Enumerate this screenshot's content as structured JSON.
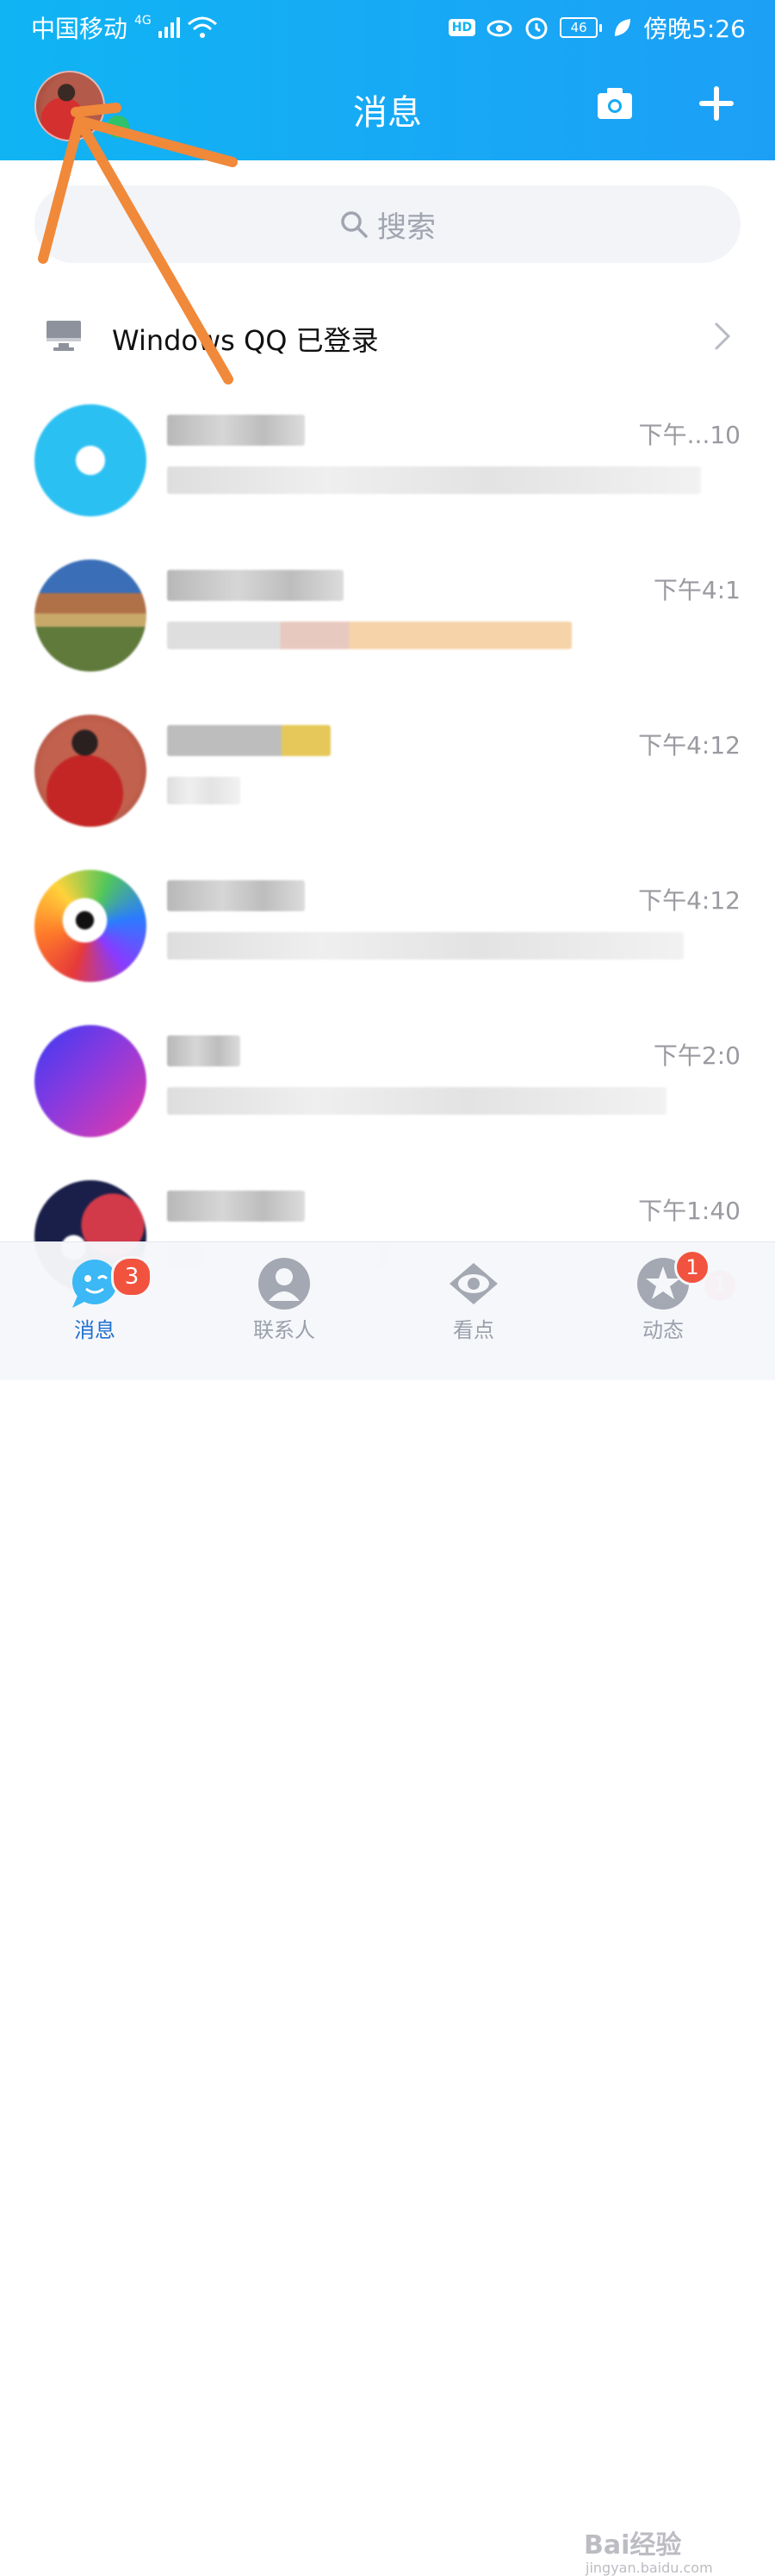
{
  "status_bar": {
    "carrier": "中国移动",
    "network": "4G",
    "hd": "HD",
    "battery": "46",
    "time": "傍晚5:26"
  },
  "header": {
    "title": "消息",
    "camera_icon": "camera-icon",
    "add_icon": "plus-icon"
  },
  "search": {
    "placeholder": "搜索",
    "icon": "search-icon"
  },
  "device_login": {
    "label": "Windows QQ 已登录",
    "icon": "monitor-icon"
  },
  "conversations": [
    {
      "time": "下午...10",
      "badge": ""
    },
    {
      "time": "下午4:1",
      "badge": ""
    },
    {
      "time": "下午4:12",
      "badge": ""
    },
    {
      "time": "下午4:12",
      "badge": ""
    },
    {
      "time": "下午2:0",
      "badge": ""
    },
    {
      "time": "下午1:40",
      "badge": "1"
    }
  ],
  "tabs": [
    {
      "label": "消息",
      "badge": "3",
      "icon": "chat-bubble-icon",
      "active": true
    },
    {
      "label": "联系人",
      "badge": "",
      "icon": "person-icon",
      "active": false
    },
    {
      "label": "看点",
      "badge": "",
      "icon": "eye-icon",
      "active": false
    },
    {
      "label": "动态",
      "badge": "1",
      "icon": "star-icon",
      "active": false
    }
  ],
  "watermark": {
    "text": "Bai经验",
    "url": "jingyan.baidu.com"
  },
  "colors": {
    "header_blue": "#16aaf5",
    "badge_red": "#f2533f",
    "annotation_orange": "#f0893a"
  }
}
